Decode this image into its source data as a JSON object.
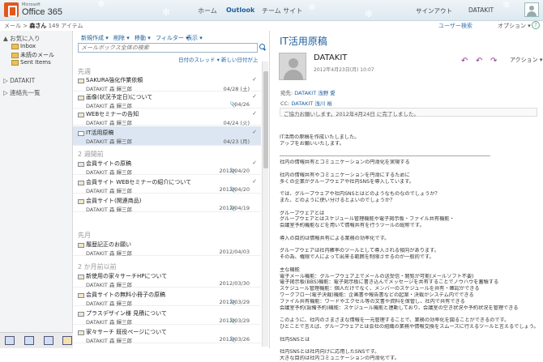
{
  "app": {
    "brand_small": "Microsoft",
    "brand": "Office 365"
  },
  "nav": {
    "home": "ホーム",
    "outlook": "Outlook",
    "team_site": "チーム サイト"
  },
  "account": {
    "sign_out": "サインアウト",
    "user": "DATAKIT",
    "user_search": "ユーザー検索",
    "options": "オプション ▾",
    "help": "?"
  },
  "breadcrumb": {
    "mail": "メール",
    "owner": "森さん",
    "count": "149 アイテム"
  },
  "sidebar": {
    "favorites": "▲ お気に入り",
    "fav_items": [
      "Inbox",
      "未読のメール",
      "Sent Items"
    ],
    "datakit": "▷ DATAKIT",
    "contacts": "▷ 連絡先一覧"
  },
  "toolbar": {
    "new": "新規作成 ▾",
    "delete": "削除 ▾",
    "move": "移動 ▾",
    "filter": "フィルター ▾",
    "view": "表示 ▾"
  },
  "search": {
    "placeholder": "メールボックス全体の検索"
  },
  "sort": {
    "thread": "日付のスレッド ▾",
    "newest": "新しい日付が上"
  },
  "groups": {
    "last_week": "先週",
    "two_weeks": "2 週間前",
    "last_month": "先月",
    "two_months": "2 か月前以前"
  },
  "messages": [
    {
      "subject": "SAKURA強化作業依頼",
      "from": "DATAKIT 森 輝三郎",
      "date": "04/28 (土)",
      "attach": ""
    },
    {
      "subject": "画像(状況予定日)について",
      "from": "DATAKIT 森 輝三郎",
      "date": "04/26",
      "attach": "📎"
    },
    {
      "subject": "WEBセミナーの告知",
      "from": "DATAKIT 森 輝三郎",
      "date": "04/24 (火)",
      "attach": ""
    },
    {
      "subject": "IT活用原稿",
      "from": "DATAKIT 森 輝三郎",
      "date": "04/23 (月)",
      "attach": ""
    },
    {
      "subject": "会員サイトの原稿",
      "from": "DATAKIT 森 輝三郎",
      "date": "2012/04/20",
      "attach": "📎"
    },
    {
      "subject": "会員サイト WEBセミナーの紹介について",
      "from": "DATAKIT 森 輝三郎",
      "date": "2012/04/20",
      "attach": "📎"
    },
    {
      "subject": "会員サイト(関連商品)",
      "from": "DATAKIT 森 輝三郎",
      "date": "2012/04/19",
      "attach": "📎"
    },
    {
      "subject": "履歴記正のお願い",
      "from": "DATAKIT 森 輝三郎",
      "date": "2012/04/03",
      "attach": ""
    },
    {
      "subject": "新使用の家々サーチHPについて",
      "from": "DATAKIT 森 輝三郎",
      "date": "2012/03/30",
      "attach": ""
    },
    {
      "subject": "会員サイトの無料小冊子の原稿",
      "from": "DATAKIT 森 輝三郎",
      "date": "2012/03/29",
      "attach": "📎"
    },
    {
      "subject": "プラスデザイン様 見積について",
      "from": "DATAKIT 森 輝三郎",
      "date": "2012/03/29",
      "attach": "📎"
    },
    {
      "subject": "家々サーチ 既役ページについて",
      "from": "DATAKIT 森 輝三郎",
      "date": "2012/03/26",
      "attach": "📎"
    }
  ],
  "reading": {
    "title": "IT活用原稿",
    "sender": "DATAKIT",
    "date": "2012年4月23日(月) 10:07",
    "actions": "アクション ▾",
    "to_label": "宛先:",
    "to": "DATAKIT 浅野 愛",
    "cc_label": "CC:",
    "cc": "DATAKIT 浅川 裕",
    "flag": "ご協力お願いします。2012年4月24日 に完了しました。",
    "body": [
      "IT活用の原稿を作成いたしました。",
      "アップをお願いいたします。",
      "",
      "――――――――――――――――――――――――――――――――――――――――――",
      "社内の情報共有とコミュニケーションの円滑化を実現する",
      "",
      "社内の情報共有やコミュニケーションを円滑にするために",
      "多くの企業がグループウェアや社内SNSを導入しています。",
      "",
      "では、グループウェアや社内SNSとはどのようなものなのでしょうか？",
      "また、どのように使い分けるとよいのでしょうか？",
      "",
      "グループウェアとは",
      "グループウェアとはスケジュール管理機能や電子掲示板・ファイル共有機能・",
      "会議室予約機能などを用いて情報共有を行うツールの総称です。",
      "",
      "導入の目的は情報共有による業務の効率化です。",
      "",
      "グループウェアは社内確率のツールとして導入される傾向があります。",
      "その為、権限で人によって出来る範囲を制限させるのが一般的です。",
      "",
      "主な機能",
      "電子メール機能：グループウェア上でメールの送受信・閲覧が可能(メールソフト不要)",
      "電子掲示板(BBS)機能：電子掲示板に書き込んでメッセージを共有することでノウハウを蓄積する",
      "スケジュール管理機能：個人だけでなく、メンバーのスケジュールを共有・確認ができる",
      "ワークフロー(電子決裁)機能：企画書や報告書などの起案・決裁がシステム内でできる",
      "ファイル共有機能：ワードやエクセル等の文書や資料を保管し、社内で共有できる",
      "会議室予約(設備予約)機能：スケジュール機能と連動しており、会議室の空き状況や予約状況を管理できる",
      "",
      "このように、社内のさまざまな情報を一元管理することで、業務の効率化を図ることができるのです。",
      "ひとことで言えば、グループウェアとは会社の組織の業務や情報交換をスムーズに行えるツールと言えるでしょう。",
      "",
      "社内SNSとは",
      "",
      "社内SNSとは社内向けに応用したSNSです。",
      "大きな目的は社内コミュニケーションの円滑化です。"
    ]
  }
}
